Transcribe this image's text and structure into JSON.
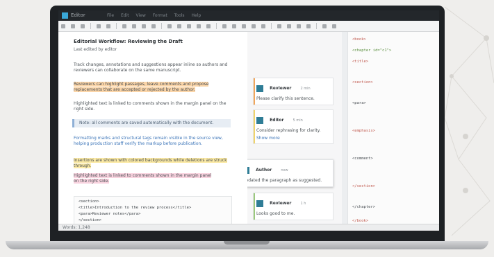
{
  "app": {
    "title": "Editor"
  },
  "menu": [
    "File",
    "Edit",
    "View",
    "Format",
    "Tools",
    "Help"
  ],
  "document": {
    "title": "Editorial Workflow: Reviewing the Draft",
    "subtitle": "Last edited by editor",
    "paragraphs": [
      "Track changes, annotations and suggestions appear inline so authors and reviewers can collaborate on the same manuscript.",
      "Reviewers can highlight passages, leave comments and propose replacements that are accepted or rejected by the author.",
      "Highlighted text is linked to comments shown in the margin panel on the right side."
    ],
    "callout": "Note: all comments are saved automatically with the document.",
    "paragraph_2": [
      "Formatting marks and structural tags remain visible in the source view, helping production staff verify the markup before publication.",
      "Insertions are shown with colored backgrounds while deletions are struck through."
    ],
    "code_lines": [
      "<section>",
      "  <title>Introduction to the review process</title>",
      "  <para>Reviewer notes</para>",
      "</section>"
    ]
  },
  "comments": [
    {
      "author": "Reviewer",
      "time": "2 min",
      "text": "Please clarify this sentence.",
      "link": ""
    },
    {
      "author": "Editor",
      "time": "5 min",
      "text": "Consider rephrasing for clarity.",
      "link": "Show more"
    },
    {
      "author": "Author",
      "time": "now",
      "text": "Updated the paragraph as suggested.",
      "link": ""
    },
    {
      "author": "Reviewer",
      "time": "1 h",
      "text": "Looks good to me.",
      "link": ""
    }
  ],
  "code_view": [
    "<book>",
    "  <chapter id=\"c1\">",
    "    <title>",
    "    <section>",
    "      <para>",
    "      <emphasis>",
    "      <comment>",
    "    </section>",
    "  </chapter>",
    "</book>"
  ],
  "status": "Words: 1,248",
  "colors": {
    "accent": "#2f7d96",
    "highlight_orange": "#fbd5a8",
    "highlight_yellow": "#fbe9a4",
    "highlight_pink": "#f9d3df"
  }
}
